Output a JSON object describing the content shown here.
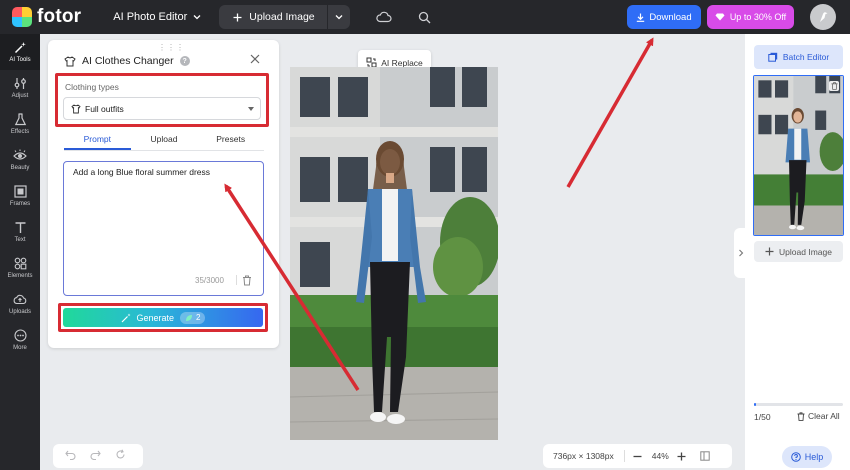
{
  "topbar": {
    "logo_text": "fotor",
    "editor_menu": "AI Photo Editor",
    "upload_label": "Upload Image",
    "download_label": "Download",
    "promo_label": "Up to 30% Off"
  },
  "rail": {
    "items": [
      {
        "label": "AI Tools",
        "icon": "magic-wand-icon"
      },
      {
        "label": "Adjust",
        "icon": "sliders-icon"
      },
      {
        "label": "Effects",
        "icon": "flask-icon"
      },
      {
        "label": "Beauty",
        "icon": "eye-icon"
      },
      {
        "label": "Frames",
        "icon": "frame-icon"
      },
      {
        "label": "Text",
        "icon": "text-icon"
      },
      {
        "label": "Elements",
        "icon": "shapes-icon"
      },
      {
        "label": "Uploads",
        "icon": "cloud-upload-icon"
      },
      {
        "label": "More",
        "icon": "more-icon"
      }
    ]
  },
  "panel": {
    "title": "AI Clothes Changer",
    "clothing_label": "Clothing types",
    "clothing_value": "Full outfits",
    "tabs": [
      "Prompt",
      "Upload",
      "Presets"
    ],
    "prompt_text": "Add a long Blue floral summer dress",
    "char_count": "35/3000",
    "generate_label": "Generate",
    "credits": "2"
  },
  "canvas": {
    "ai_replace_label": "AI Replace",
    "dimensions": "736px × 1308px",
    "zoom": "44%"
  },
  "right_panel": {
    "batch_editor_label": "Batch Editor",
    "upload_image_label": "Upload Image",
    "count": "1/50",
    "clear_all_label": "Clear All",
    "progress": 0.02
  },
  "help_label": "Help",
  "colors": {
    "accent": "#2f6df6",
    "promo": "#d84be8",
    "annotation": "#d72b33"
  }
}
